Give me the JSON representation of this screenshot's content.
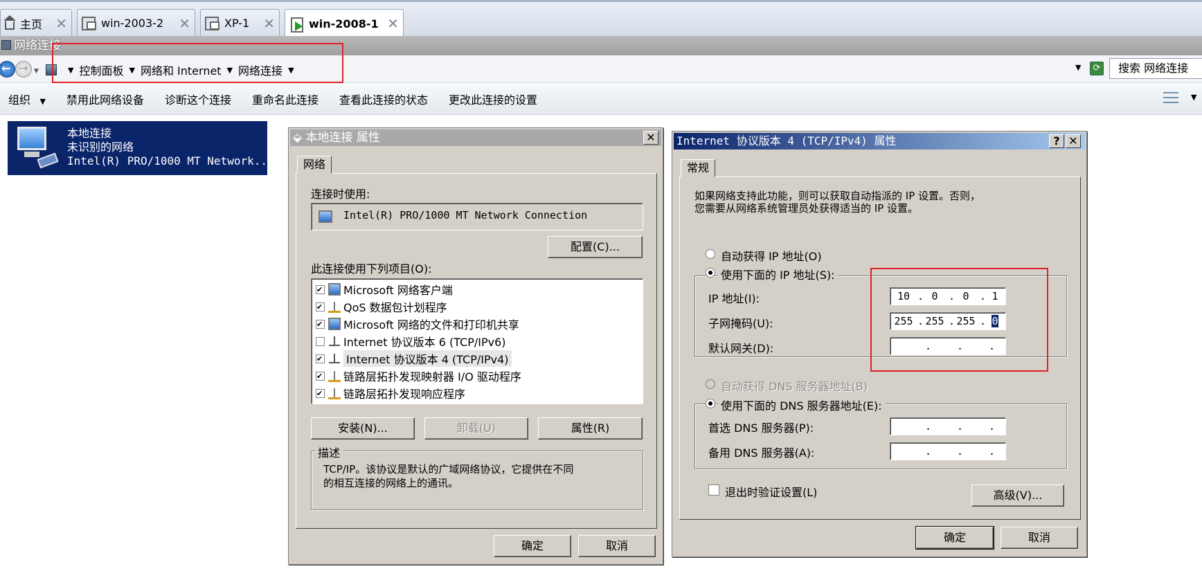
{
  "vm_tabs": [
    {
      "label": "主页",
      "icon": "home-icon"
    },
    {
      "label": "win-2003-2",
      "icon": "vm-icon"
    },
    {
      "label": "XP-1",
      "icon": "vm-icon"
    },
    {
      "label": "win-2008-1",
      "icon": "vm-running-icon",
      "active": true
    }
  ],
  "window": {
    "title": "网络连接"
  },
  "breadcrumb": {
    "items": [
      "控制面板",
      "网络和 Internet",
      "网络连接"
    ]
  },
  "search": {
    "placeholder": "搜索 网络连接"
  },
  "toolbar": {
    "organize": "组织",
    "disable": "禁用此网络设备",
    "diagnose": "诊断这个连接",
    "rename": "重命名此连接",
    "status": "查看此连接的状态",
    "change": "更改此连接的设置"
  },
  "connection": {
    "name": "本地连接",
    "status": "未识别的网络",
    "adapter": "Intel(R) PRO/1000 MT Network..."
  },
  "props_dialog": {
    "title": "本地连接 属性",
    "tab": "网络",
    "connect_using_label": "连接时使用:",
    "adapter_name": "Intel(R) PRO/1000 MT Network Connection",
    "configure_button": "配置(C)...",
    "items_label": "此连接使用下列项目(O):",
    "components": [
      {
        "label": "Microsoft 网络客户端",
        "checked": true,
        "icon": "client-icon"
      },
      {
        "label": "QoS 数据包计划程序",
        "checked": true,
        "icon": "qos-icon"
      },
      {
        "label": "Microsoft 网络的文件和打印机共享",
        "checked": true,
        "icon": "share-icon"
      },
      {
        "label": "Internet 协议版本 6 (TCP/IPv6)",
        "checked": false,
        "icon": "protocol-icon"
      },
      {
        "label": "Internet 协议版本 4 (TCP/IPv4)",
        "checked": true,
        "icon": "protocol-icon",
        "selected": true
      },
      {
        "label": "链路层拓扑发现映射器 I/O 驱动程序",
        "checked": true,
        "icon": "protocol-icon"
      },
      {
        "label": "链路层拓扑发现响应程序",
        "checked": true,
        "icon": "protocol-icon"
      }
    ],
    "install_button": "安装(N)...",
    "uninstall_button": "卸载(U)",
    "properties_button": "属性(R)",
    "description_caption": "描述",
    "description_line1": "TCP/IP。该协议是默认的广域网络协议，它提供在不同",
    "description_line2": "的相互连接的网络上的通讯。",
    "ok_button": "确定",
    "cancel_button": "取消"
  },
  "ipv4_dialog": {
    "title": "Internet 协议版本 4 (TCP/IPv4) 属性",
    "help_button": "?",
    "tab": "常规",
    "intro_line1": "如果网络支持此功能，则可以获取自动指派的 IP 设置。否则，",
    "intro_line2": "您需要从网络系统管理员处获得适当的 IP 设置。",
    "auto_ip_label": "自动获得 IP 地址(O)",
    "manual_ip_label": "使用下面的 IP 地址(S):",
    "ip_label": "IP 地址(I):",
    "ip_octets": [
      "10",
      "0",
      "0",
      "1"
    ],
    "mask_label": "子网掩码(U):",
    "mask_octets": [
      "255",
      "255",
      "255",
      "0"
    ],
    "gateway_label": "默认网关(D):",
    "gateway_octets": [
      "",
      "",
      "",
      ""
    ],
    "auto_dns_label": "自动获得 DNS 服务器地址(B)",
    "manual_dns_label": "使用下面的 DNS 服务器地址(E):",
    "preferred_dns_label": "首选 DNS 服务器(P):",
    "preferred_dns_octets": [
      "",
      "",
      "",
      ""
    ],
    "alternate_dns_label": "备用 DNS 服务器(A):",
    "alternate_dns_octets": [
      "",
      "",
      "",
      ""
    ],
    "validate_label": "退出时验证设置(L)",
    "advanced_button": "高级(V)...",
    "ok_button": "确定",
    "cancel_button": "取消"
  },
  "colors": {
    "highlight": "#e0202a",
    "selection": "#0a246a",
    "dialog_face": "#d4d0c8"
  }
}
